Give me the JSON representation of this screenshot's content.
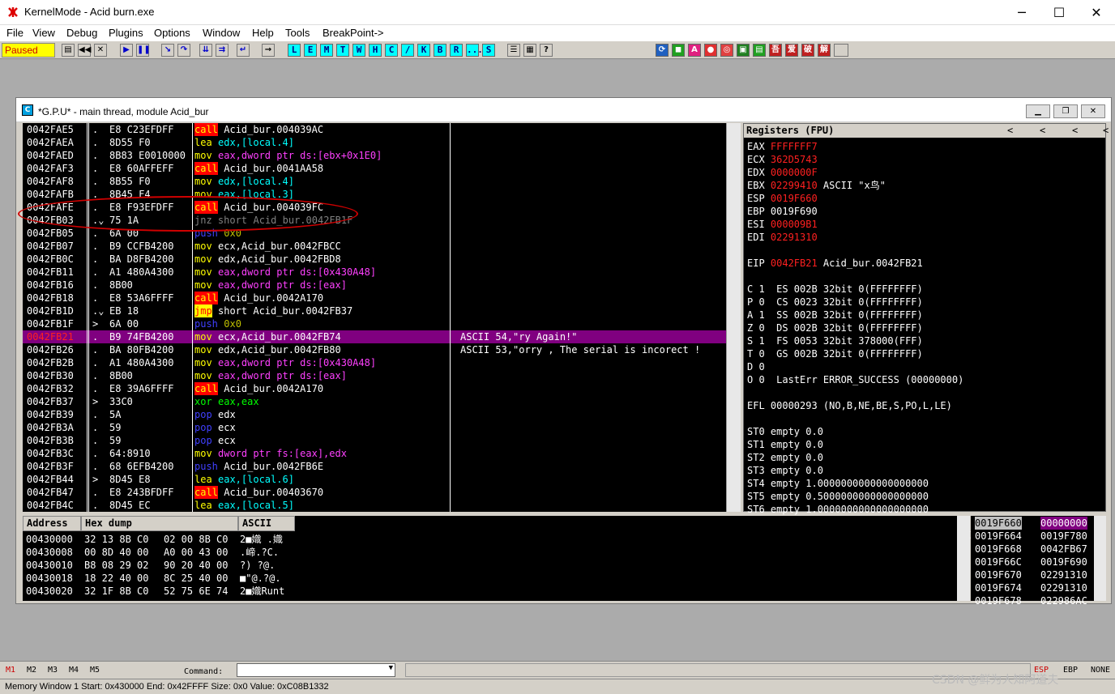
{
  "window": {
    "title": "KernelMode - Acid burn.exe",
    "minimize": "─",
    "maximize": "☐",
    "close": "✕"
  },
  "menu": [
    "File",
    "View",
    "Debug",
    "Plugins",
    "Options",
    "Window",
    "Help",
    "Tools",
    "BreakPoint->"
  ],
  "toolbar": {
    "status": "Paused",
    "letters": [
      "L",
      "E",
      "M",
      "T",
      "W",
      "H",
      "C",
      "/",
      "K",
      "B",
      "R",
      "...",
      "S"
    ],
    "right_icons": [
      "吾",
      "爱",
      "破",
      "解"
    ]
  },
  "cpu": {
    "title": "*G.P.U* - main thread, module Acid_bur"
  },
  "disasm": [
    {
      "addr": "0042FAE5",
      "mark": ".",
      "hex": "E8 C23EFDFF",
      "op": "call",
      "args": "Acid_bur.004039AC",
      "cm": ""
    },
    {
      "addr": "0042FAEA",
      "mark": ".",
      "hex": "8D55 F0",
      "op": "lea",
      "args": "edx,[local.4]",
      "cm": ""
    },
    {
      "addr": "0042FAED",
      "mark": ".",
      "hex": "8B83 E0010000",
      "op": "mov",
      "args": "eax,dword ptr ds:[ebx+0x1E0]",
      "cm": ""
    },
    {
      "addr": "0042FAF3",
      "mark": ".",
      "hex": "E8 60AFFEFF",
      "op": "call",
      "args": "Acid_bur.0041AA58",
      "cm": ""
    },
    {
      "addr": "0042FAF8",
      "mark": ".",
      "hex": "8B55 F0",
      "op": "mov",
      "args": "edx,[local.4]",
      "cm": ""
    },
    {
      "addr": "0042FAFB",
      "mark": ".",
      "hex": "8B45 F4",
      "op": "mov",
      "args": "eax,[local.3]",
      "cm": ""
    },
    {
      "addr": "0042FAFE",
      "mark": ".",
      "hex": "E8 F93EFDFF",
      "op": "call",
      "args": "Acid_bur.004039FC",
      "cm": ""
    },
    {
      "addr": "0042FB03",
      "mark": ".⌄",
      "hex": "75 1A",
      "op": "jnz short",
      "args": "Acid_bur.0042FB1F",
      "cm": ""
    },
    {
      "addr": "0042FB05",
      "mark": ".",
      "hex": "6A 00",
      "op": "push",
      "args": "0x0",
      "cm": ""
    },
    {
      "addr": "0042FB07",
      "mark": ".",
      "hex": "B9 CCFB4200",
      "op": "mov",
      "args": "ecx,Acid_bur.0042FBCC",
      "cm": ""
    },
    {
      "addr": "0042FB0C",
      "mark": ".",
      "hex": "BA D8FB4200",
      "op": "mov",
      "args": "edx,Acid_bur.0042FBD8",
      "cm": ""
    },
    {
      "addr": "0042FB11",
      "mark": ".",
      "hex": "A1 480A4300",
      "op": "mov",
      "args": "eax,dword ptr ds:[0x430A48]",
      "cm": ""
    },
    {
      "addr": "0042FB16",
      "mark": ".",
      "hex": "8B00",
      "op": "mov",
      "args": "eax,dword ptr ds:[eax]",
      "cm": ""
    },
    {
      "addr": "0042FB18",
      "mark": ".",
      "hex": "E8 53A6FFFF",
      "op": "call",
      "args": "Acid_bur.0042A170",
      "cm": ""
    },
    {
      "addr": "0042FB1D",
      "mark": ".⌄",
      "hex": "EB 18",
      "op": "jmp",
      "args": "short Acid_bur.0042FB37",
      "cm": ""
    },
    {
      "addr": "0042FB1F",
      "mark": ">",
      "hex": "6A 00",
      "op": "push",
      "args": "0x0",
      "cm": ""
    },
    {
      "addr": "0042FB21",
      "mark": ".",
      "hex": "B9 74FB4200",
      "op": "mov",
      "args": "ecx,Acid_bur.0042FB74",
      "cm": "ASCII 54,\"ry Again!\""
    },
    {
      "addr": "0042FB26",
      "mark": ".",
      "hex": "BA 80FB4200",
      "op": "mov",
      "args": "edx,Acid_bur.0042FB80",
      "cm": "ASCII 53,\"orry , The serial is incorect !"
    },
    {
      "addr": "0042FB2B",
      "mark": ".",
      "hex": "A1 480A4300",
      "op": "mov",
      "args": "eax,dword ptr ds:[0x430A48]",
      "cm": ""
    },
    {
      "addr": "0042FB30",
      "mark": ".",
      "hex": "8B00",
      "op": "mov",
      "args": "eax,dword ptr ds:[eax]",
      "cm": ""
    },
    {
      "addr": "0042FB32",
      "mark": ".",
      "hex": "E8 39A6FFFF",
      "op": "call",
      "args": "Acid_bur.0042A170",
      "cm": ""
    },
    {
      "addr": "0042FB37",
      "mark": ">",
      "hex": "33C0",
      "op": "xor",
      "args": "eax,eax",
      "cm": ""
    },
    {
      "addr": "0042FB39",
      "mark": ".",
      "hex": "5A",
      "op": "pop",
      "args": "edx",
      "cm": ""
    },
    {
      "addr": "0042FB3A",
      "mark": ".",
      "hex": "59",
      "op": "pop",
      "args": "ecx",
      "cm": ""
    },
    {
      "addr": "0042FB3B",
      "mark": ".",
      "hex": "59",
      "op": "pop",
      "args": "ecx",
      "cm": ""
    },
    {
      "addr": "0042FB3C",
      "mark": ".",
      "hex": "64:8910",
      "op": "mov",
      "args": "dword ptr fs:[eax],edx",
      "cm": ""
    },
    {
      "addr": "0042FB3F",
      "mark": ".",
      "hex": "68 6EFB4200",
      "op": "push",
      "args": "Acid_bur.0042FB6E",
      "cm": ""
    },
    {
      "addr": "0042FB44",
      "mark": ">",
      "hex": "8D45 E8",
      "op": "lea",
      "args": "eax,[local.6]",
      "cm": ""
    },
    {
      "addr": "0042FB47",
      "mark": ".",
      "hex": "E8 243BFDFF",
      "op": "call",
      "args": "Acid_bur.00403670",
      "cm": ""
    },
    {
      "addr": "0042FB4C",
      "mark": ".",
      "hex": "8D45 EC",
      "op": "lea",
      "args": "eax,[local.5]",
      "cm": ""
    }
  ],
  "regs": {
    "header": "Registers (FPU)",
    "lines": [
      {
        "t": "EAX ",
        "v": "FFFFFFF7",
        "red": true,
        "x": ""
      },
      {
        "t": "ECX ",
        "v": "362D5743",
        "red": true,
        "x": ""
      },
      {
        "t": "EDX ",
        "v": "0000000F",
        "red": true,
        "x": ""
      },
      {
        "t": "EBX ",
        "v": "02299410",
        "red": true,
        "x": " ASCII \"x鸟\""
      },
      {
        "t": "ESP ",
        "v": "0019F660",
        "red": true,
        "x": ""
      },
      {
        "t": "EBP ",
        "v": "0019F690",
        "red": false,
        "x": ""
      },
      {
        "t": "ESI ",
        "v": "000009B1",
        "red": true,
        "x": ""
      },
      {
        "t": "EDI ",
        "v": "02291310",
        "red": true,
        "x": ""
      },
      {
        "t": "",
        "v": "",
        "red": false,
        "x": ""
      },
      {
        "t": "EIP ",
        "v": "0042FB21",
        "red": true,
        "x": " Acid_bur.0042FB21"
      },
      {
        "t": "",
        "v": "",
        "red": false,
        "x": ""
      },
      {
        "t": "C 1  ES 002B 32bit 0(FFFFFFFF)",
        "v": "",
        "red": false,
        "x": ""
      },
      {
        "t": "P 0  CS 0023 32bit 0(FFFFFFFF)",
        "v": "",
        "red": false,
        "x": ""
      },
      {
        "t": "A 1  SS 002B 32bit 0(FFFFFFFF)",
        "v": "",
        "red": false,
        "x": ""
      },
      {
        "t": "Z 0  DS 002B 32bit 0(FFFFFFFF)",
        "v": "",
        "red": false,
        "x": ""
      },
      {
        "t": "S 1  FS 0053 32bit 378000(FFF)",
        "v": "",
        "red": false,
        "x": ""
      },
      {
        "t": "T 0  GS 002B 32bit 0(FFFFFFFF)",
        "v": "",
        "red": false,
        "x": ""
      },
      {
        "t": "D 0",
        "v": "",
        "red": false,
        "x": ""
      },
      {
        "t": "O 0  LastErr ERROR_SUCCESS (00000000)",
        "v": "",
        "red": false,
        "x": ""
      },
      {
        "t": "",
        "v": "",
        "red": false,
        "x": ""
      },
      {
        "t": "EFL 00000293 (NO,B,NE,BE,S,PO,L,LE)",
        "v": "",
        "red": false,
        "x": ""
      },
      {
        "t": "",
        "v": "",
        "red": false,
        "x": ""
      },
      {
        "t": "ST0 empty 0.0",
        "v": "",
        "red": false,
        "x": ""
      },
      {
        "t": "ST1 empty 0.0",
        "v": "",
        "red": false,
        "x": ""
      },
      {
        "t": "ST2 empty 0.0",
        "v": "",
        "red": false,
        "x": ""
      },
      {
        "t": "ST3 empty 0.0",
        "v": "",
        "red": false,
        "x": ""
      },
      {
        "t": "ST4 empty 1.0000000000000000000",
        "v": "",
        "red": false,
        "x": ""
      },
      {
        "t": "ST5 empty 0.5000000000000000000",
        "v": "",
        "red": false,
        "x": ""
      },
      {
        "t": "ST6 empty 1.0000000000000000000",
        "v": "",
        "red": false,
        "x": ""
      },
      {
        "t": "ST7 empty 0.0",
        "v": "",
        "red": false,
        "x": ""
      },
      {
        "t": "               3 2 1 0      E S P U O Z D I",
        "v": "",
        "red": false,
        "x": ""
      }
    ]
  },
  "dump": {
    "headers": [
      "Address",
      "Hex dump",
      "ASCII"
    ],
    "rows": [
      {
        "a": "00430000",
        "h1": "32 13 8B C0",
        "h2": "02 00 8B C0",
        "s": "2■嬂 .嬂"
      },
      {
        "a": "00430008",
        "h1": "00 8D 40 00",
        "h2": "A0 00 43 00",
        "s": ".崹.?C."
      },
      {
        "a": "00430010",
        "h1": "B8 08 29 02",
        "h2": "90 20 40 00",
        "s": "?) ?@."
      },
      {
        "a": "00430018",
        "h1": "18 22 40 00",
        "h2": "8C 25 40 00",
        "s": "■\"@.?@."
      },
      {
        "a": "00430020",
        "h1": "32 1F 8B C0",
        "h2": "52 75 6E 74",
        "s": "2■嬂Runt"
      }
    ]
  },
  "stack": [
    {
      "a": "0019F660",
      "v": "00000000",
      "sel": true
    },
    {
      "a": "0019F664",
      "v": "0019F780",
      "sel": false
    },
    {
      "a": "0019F668",
      "v": "0042FB67",
      "sel": false
    },
    {
      "a": "0019F66C",
      "v": "0019F690",
      "sel": false
    },
    {
      "a": "0019F670",
      "v": "02291310",
      "sel": false
    },
    {
      "a": "0019F674",
      "v": "02291310",
      "sel": false
    },
    {
      "a": "0019F678",
      "v": "022986AC",
      "sel": false
    }
  ],
  "bottom": {
    "marks": [
      "M1",
      "M2",
      "M3",
      "M4",
      "M5"
    ],
    "command_label": "Command:",
    "right": [
      "ESP",
      "EBP",
      "NONE"
    ]
  },
  "status": "Memory Window 1  Start: 0x430000  End: 0x42FFFF  Size: 0x0 Value: 0xC08B1332",
  "watermark": "CSDN @鲜为人知阿道夫"
}
